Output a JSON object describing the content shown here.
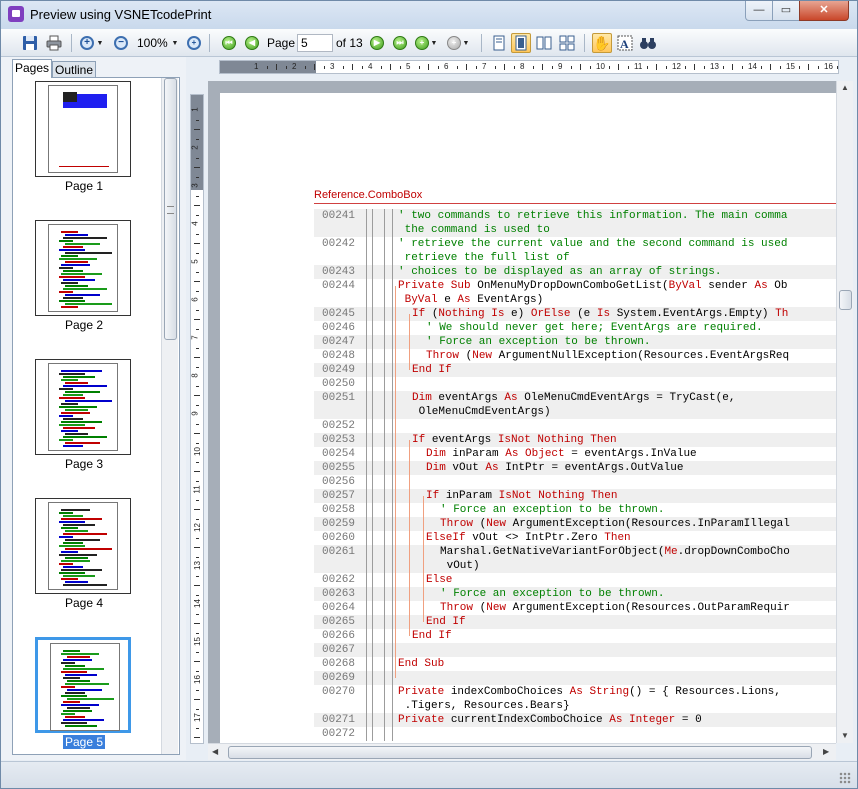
{
  "window": {
    "title": "Preview using VSNETcodePrint",
    "minimize": "—",
    "maximize": "▭",
    "close": "✕"
  },
  "toolbar": {
    "zoom": "100%",
    "page_label": "Page",
    "page_value": "5",
    "page_total": "of 13"
  },
  "tabs": {
    "pages": "Pages",
    "outline": "Outline"
  },
  "thumbnails": [
    {
      "label": "Page 1",
      "selected": false
    },
    {
      "label": "Page 2",
      "selected": false
    },
    {
      "label": "Page 3",
      "selected": false
    },
    {
      "label": "Page 4",
      "selected": false
    },
    {
      "label": "Page 5",
      "selected": true
    }
  ],
  "hruler": {
    "numbers": [
      "1",
      "2",
      "3",
      "4",
      "5",
      "6",
      "7",
      "8",
      "9",
      "10",
      "11",
      "12",
      "13",
      "14",
      "15",
      "16"
    ]
  },
  "vruler": {
    "numbers": [
      "1",
      "2",
      "3",
      "4",
      "5",
      "6",
      "7",
      "8",
      "9",
      "10",
      "11",
      "12",
      "13",
      "14",
      "15",
      "16",
      "17"
    ]
  },
  "document": {
    "header": "Reference.ComboBox",
    "lines": [
      {
        "num": "00241",
        "parts": [
          [
            "cm",
            "' two commands to retrieve this information. The main comma"
          ]
        ],
        "indent": 3
      },
      {
        "num": "",
        "parts": [
          [
            "cm",
            " the command is used to"
          ]
        ],
        "indent": 3
      },
      {
        "num": "00242",
        "parts": [
          [
            "cm",
            "' retrieve the current value and the second command is used"
          ]
        ],
        "indent": 3
      },
      {
        "num": "",
        "parts": [
          [
            "cm",
            " retrieve the full list of"
          ]
        ],
        "indent": 3
      },
      {
        "num": "00243",
        "parts": [
          [
            "cm",
            "' choices to be displayed as an array of strings."
          ]
        ],
        "indent": 3
      },
      {
        "num": "00244",
        "parts": [
          [
            "kw",
            "Private Sub "
          ],
          [
            "pl",
            "OnMenuMyDropDownComboGetList("
          ],
          [
            "kw",
            "ByVal "
          ],
          [
            "pl",
            "sender "
          ],
          [
            "kw",
            "As "
          ],
          [
            "pl",
            "Ob"
          ]
        ],
        "indent": 3
      },
      {
        "num": "",
        "parts": [
          [
            "kw",
            " ByVal "
          ],
          [
            "pl",
            "e "
          ],
          [
            "kw",
            "As "
          ],
          [
            "pl",
            "EventArgs)"
          ]
        ],
        "indent": 3
      },
      {
        "num": "00245",
        "parts": [
          [
            "kw",
            "If "
          ],
          [
            "pl",
            "("
          ],
          [
            "kw",
            "Nothing Is "
          ],
          [
            "pl",
            "e) "
          ],
          [
            "kw",
            "OrElse "
          ],
          [
            "pl",
            "(e "
          ],
          [
            "kw",
            "Is "
          ],
          [
            "pl",
            "System.EventArgs.Empty) "
          ],
          [
            "kw",
            "Th"
          ]
        ],
        "indent": 4
      },
      {
        "num": "00246",
        "parts": [
          [
            "cm",
            "' We should never get here; EventArgs are required."
          ]
        ],
        "indent": 5
      },
      {
        "num": "00247",
        "parts": [
          [
            "cm",
            "' Force an exception to be thrown."
          ]
        ],
        "indent": 5
      },
      {
        "num": "00248",
        "parts": [
          [
            "kw",
            "Throw "
          ],
          [
            "pl",
            "("
          ],
          [
            "kw",
            "New "
          ],
          [
            "pl",
            "ArgumentNullException(Resources.EventArgsReq"
          ]
        ],
        "indent": 5
      },
      {
        "num": "00249",
        "parts": [
          [
            "kw",
            "End If"
          ]
        ],
        "indent": 4
      },
      {
        "num": "00250",
        "parts": [],
        "indent": 3
      },
      {
        "num": "00251",
        "parts": [
          [
            "kw",
            "Dim "
          ],
          [
            "pl",
            "eventArgs "
          ],
          [
            "kw",
            "As "
          ],
          [
            "pl",
            "OleMenuCmdEventArgs = TryCast(e,"
          ]
        ],
        "indent": 4
      },
      {
        "num": "",
        "parts": [
          [
            "pl",
            " OleMenuCmdEventArgs)"
          ]
        ],
        "indent": 4
      },
      {
        "num": "00252",
        "parts": [],
        "indent": 3
      },
      {
        "num": "00253",
        "parts": [
          [
            "kw",
            "If "
          ],
          [
            "pl",
            "eventArgs "
          ],
          [
            "kw",
            "IsNot Nothing Then"
          ]
        ],
        "indent": 4
      },
      {
        "num": "00254",
        "parts": [
          [
            "kw",
            "Dim "
          ],
          [
            "pl",
            "inParam "
          ],
          [
            "kw",
            "As Object "
          ],
          [
            "pl",
            "= eventArgs.InValue"
          ]
        ],
        "indent": 5
      },
      {
        "num": "00255",
        "parts": [
          [
            "kw",
            "Dim "
          ],
          [
            "pl",
            "vOut "
          ],
          [
            "kw",
            "As "
          ],
          [
            "pl",
            "IntPtr = eventArgs.OutValue"
          ]
        ],
        "indent": 5
      },
      {
        "num": "00256",
        "parts": [],
        "indent": 4
      },
      {
        "num": "00257",
        "parts": [
          [
            "kw",
            "If "
          ],
          [
            "pl",
            "inParam "
          ],
          [
            "kw",
            "IsNot Nothing Then"
          ]
        ],
        "indent": 5
      },
      {
        "num": "00258",
        "parts": [
          [
            "cm",
            "' Force an exception to be thrown."
          ]
        ],
        "indent": 6
      },
      {
        "num": "00259",
        "parts": [
          [
            "kw",
            "Throw "
          ],
          [
            "pl",
            "("
          ],
          [
            "kw",
            "New "
          ],
          [
            "pl",
            "ArgumentException(Resources.InParamIllegal"
          ]
        ],
        "indent": 6
      },
      {
        "num": "00260",
        "parts": [
          [
            "kw",
            "ElseIf "
          ],
          [
            "pl",
            "vOut <> IntPtr.Zero "
          ],
          [
            "kw",
            "Then"
          ]
        ],
        "indent": 5
      },
      {
        "num": "00261",
        "parts": [
          [
            "pl",
            "Marshal.GetNativeVariantForObject("
          ],
          [
            "kw",
            "Me"
          ],
          [
            "pl",
            ".dropDownComboCho"
          ]
        ],
        "indent": 6
      },
      {
        "num": "",
        "parts": [
          [
            "pl",
            " vOut)"
          ]
        ],
        "indent": 6
      },
      {
        "num": "00262",
        "parts": [
          [
            "kw",
            "Else"
          ]
        ],
        "indent": 5
      },
      {
        "num": "00263",
        "parts": [
          [
            "cm",
            "' Force an exception to be thrown."
          ]
        ],
        "indent": 6
      },
      {
        "num": "00264",
        "parts": [
          [
            "kw",
            "Throw "
          ],
          [
            "pl",
            "("
          ],
          [
            "kw",
            "New "
          ],
          [
            "pl",
            "ArgumentException(Resources.OutParamRequir"
          ]
        ],
        "indent": 6
      },
      {
        "num": "00265",
        "parts": [
          [
            "kw",
            "End If"
          ]
        ],
        "indent": 5
      },
      {
        "num": "00266",
        "parts": [
          [
            "kw",
            "End If"
          ]
        ],
        "indent": 4
      },
      {
        "num": "00267",
        "parts": [],
        "indent": 3
      },
      {
        "num": "00268",
        "parts": [
          [
            "kw",
            "End Sub"
          ]
        ],
        "indent": 3
      },
      {
        "num": "00269",
        "parts": [],
        "indent": 3
      },
      {
        "num": "00270",
        "parts": [
          [
            "kw",
            "Private "
          ],
          [
            "pl",
            "indexComboChoices "
          ],
          [
            "kw",
            "As String"
          ],
          [
            "pl",
            "() = { Resources.Lions,"
          ]
        ],
        "indent": 3
      },
      {
        "num": "",
        "parts": [
          [
            "pl",
            " .Tigers, Resources.Bears}"
          ]
        ],
        "indent": 3
      },
      {
        "num": "00271",
        "parts": [
          [
            "kw",
            "Private "
          ],
          [
            "pl",
            "currentIndexComboChoice "
          ],
          [
            "kw",
            "As Integer "
          ],
          [
            "pl",
            "= 0"
          ]
        ],
        "indent": 3
      },
      {
        "num": "00272",
        "parts": [],
        "indent": 3
      }
    ]
  }
}
